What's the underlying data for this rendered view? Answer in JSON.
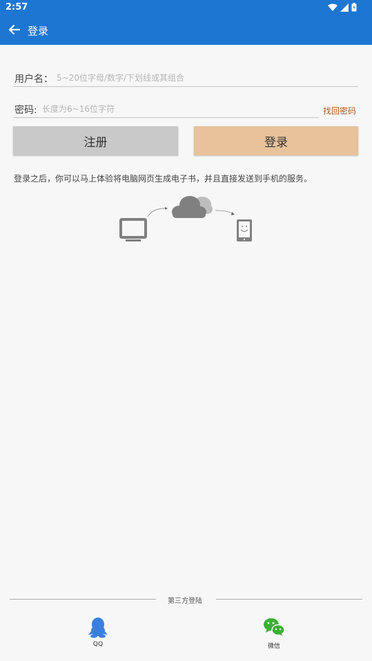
{
  "status_bar": {
    "time": "2:57"
  },
  "app_bar": {
    "title": "登录"
  },
  "form": {
    "username_label": "用户名：",
    "username_placeholder": "5~20位字母/数字/下划线或其组合",
    "username_value": "",
    "password_label": "密码:",
    "password_placeholder": "长度为6~16位字符",
    "password_value": "",
    "forgot_password": "找回密码"
  },
  "buttons": {
    "register": "注册",
    "login": "登录"
  },
  "description": "登录之后，你可以马上体验将电脑网页生成电子书，并且直接发送到手机的服务。",
  "illustration": {
    "icons": [
      "monitor-icon",
      "cloud-icon",
      "phone-icon"
    ]
  },
  "third_party": {
    "title": "第三方登陆",
    "qq_label": "QQ",
    "wechat_label": "微信"
  },
  "colors": {
    "primary": "#1d76d2",
    "login_button": "#e8c29b",
    "register_button": "#c9c9c9",
    "forgot_link": "#b05a20",
    "wechat": "#3bb033",
    "qq": "#3a7fe0"
  }
}
